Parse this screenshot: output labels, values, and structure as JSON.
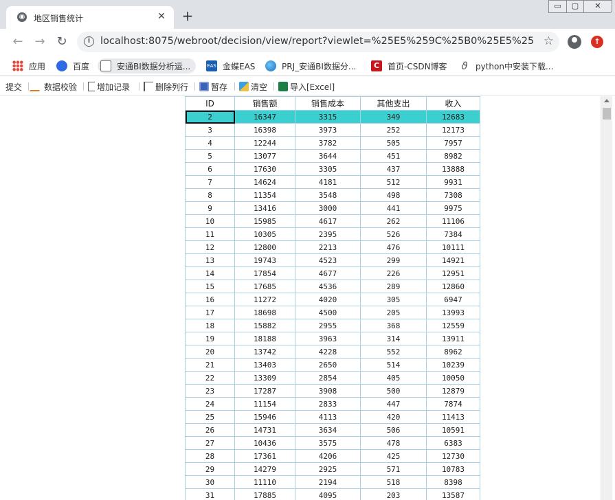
{
  "browser": {
    "tab_title": "地区销售统计",
    "url": "localhost:8075/webroot/decision/view/report?viewlet=%25E5%259C%25B0%25E5%258C%2...",
    "window_controls": {
      "minimize": "▭",
      "maximize": "▢",
      "close": "✕"
    }
  },
  "bookmarks": [
    {
      "label": "应用",
      "icon": "apps-icon"
    },
    {
      "label": "百度",
      "icon": "baidu-icon"
    },
    {
      "label": "安通BI数据分析运...",
      "icon": "chart-icon"
    },
    {
      "label": "金蝶EAS",
      "icon": "eas-icon"
    },
    {
      "label": "PRJ_安通BI数据分...",
      "icon": "globe-icon"
    },
    {
      "label": "首页-CSDN博客",
      "icon": "csdn-icon"
    },
    {
      "label": "python中安装下载...",
      "icon": "python-icon"
    }
  ],
  "report_toolbar": {
    "submit": "提交",
    "validate": "数据校验",
    "add_record": "增加记录",
    "delete_row": "删除列行",
    "save_draft": "暂存",
    "clear": "清空",
    "import_excel": "导入[Excel]"
  },
  "table": {
    "headers": [
      "ID",
      "销售额",
      "销售成本",
      "其他支出",
      "收入"
    ],
    "selected_row_id": "2",
    "rows": [
      [
        "2",
        "16347",
        "3315",
        "349",
        "12683"
      ],
      [
        "3",
        "16398",
        "3973",
        "252",
        "12173"
      ],
      [
        "4",
        "12244",
        "3782",
        "505",
        "7957"
      ],
      [
        "5",
        "13077",
        "3644",
        "451",
        "8982"
      ],
      [
        "6",
        "17630",
        "3305",
        "437",
        "13888"
      ],
      [
        "7",
        "14624",
        "4181",
        "512",
        "9931"
      ],
      [
        "8",
        "11354",
        "3548",
        "498",
        "7308"
      ],
      [
        "9",
        "13416",
        "3000",
        "441",
        "9975"
      ],
      [
        "10",
        "15985",
        "4617",
        "262",
        "11106"
      ],
      [
        "11",
        "10305",
        "2395",
        "526",
        "7384"
      ],
      [
        "12",
        "12800",
        "2213",
        "476",
        "10111"
      ],
      [
        "13",
        "19743",
        "4523",
        "299",
        "14921"
      ],
      [
        "14",
        "17854",
        "4677",
        "226",
        "12951"
      ],
      [
        "15",
        "17685",
        "4536",
        "289",
        "12860"
      ],
      [
        "16",
        "11272",
        "4020",
        "305",
        "6947"
      ],
      [
        "17",
        "18698",
        "4500",
        "205",
        "13993"
      ],
      [
        "18",
        "15882",
        "2955",
        "368",
        "12559"
      ],
      [
        "19",
        "18188",
        "3963",
        "314",
        "13911"
      ],
      [
        "20",
        "13742",
        "4228",
        "552",
        "8962"
      ],
      [
        "21",
        "13403",
        "2650",
        "514",
        "10239"
      ],
      [
        "22",
        "13309",
        "2854",
        "405",
        "10050"
      ],
      [
        "23",
        "17287",
        "3908",
        "500",
        "12879"
      ],
      [
        "24",
        "11154",
        "2833",
        "447",
        "7874"
      ],
      [
        "25",
        "15946",
        "4113",
        "420",
        "11413"
      ],
      [
        "26",
        "14731",
        "3634",
        "506",
        "10591"
      ],
      [
        "27",
        "10436",
        "3575",
        "478",
        "6383"
      ],
      [
        "28",
        "17361",
        "4206",
        "425",
        "12730"
      ],
      [
        "29",
        "14279",
        "2925",
        "571",
        "10783"
      ],
      [
        "30",
        "11110",
        "2194",
        "518",
        "8398"
      ],
      [
        "31",
        "17885",
        "4095",
        "203",
        "13587"
      ]
    ]
  }
}
